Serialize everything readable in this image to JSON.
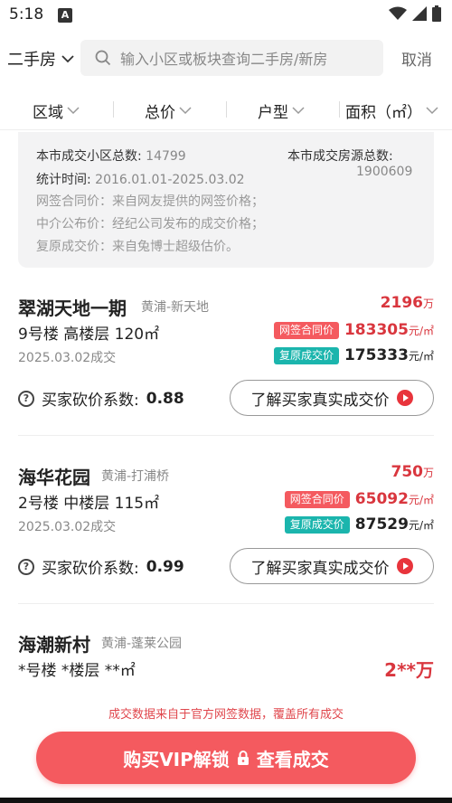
{
  "status": {
    "time": "5:18",
    "app_icon_letter": "A"
  },
  "search": {
    "city_label": "二手房",
    "placeholder": "输入小区或板块查询二手房/新房",
    "cancel_label": "取消"
  },
  "filters": [
    "区域",
    "总价",
    "户型",
    "面积（㎡）"
  ],
  "info": {
    "community_count_label": "本市成交小区总数:",
    "community_count_value": "14799",
    "listing_count_label": "本市成交房源总数:",
    "listing_count_value": "1900609",
    "period_label": "统计时间:",
    "period_value": "2016.01.01-2025.03.02",
    "note1": "网签合同价：来自网友提供的网签价格；",
    "note2": "中介公布价：经纪公司发布的成交价格；",
    "note3": "复原成交价：来自兔博士超级估价。"
  },
  "listings": [
    {
      "name": "翠湖天地一期",
      "district": "黄浦-新天地",
      "total": "2196",
      "total_unit": "万",
      "spec": "9号楼 高楼层 120㎡",
      "date": "2025.03.02成交",
      "tag1": "网签合同价",
      "price1": "183305",
      "tag2": "复原成交价",
      "price2": "175333",
      "price_unit": "元/㎡",
      "coef_label": "买家砍价系数:",
      "coef_value": "0.88",
      "cta": "了解买家真实成交价"
    },
    {
      "name": "海华花园",
      "district": "黄浦-打浦桥",
      "total": "750",
      "total_unit": "万",
      "spec": "2号楼 中楼层 115㎡",
      "date": "2025.03.02成交",
      "tag1": "网签合同价",
      "price1": "65092",
      "tag2": "复原成交价",
      "price2": "87529",
      "price_unit": "元/㎡",
      "coef_label": "买家砍价系数:",
      "coef_value": "0.99",
      "cta": "了解买家真实成交价"
    },
    {
      "name": "海潮新村",
      "district": "黄浦-蓬莱公园",
      "total_masked": "2**万",
      "spec": "*号楼 *楼层 **㎡"
    }
  ],
  "footnote": "成交数据来自于官方网签数据，覆盖所有成交",
  "vip_button": {
    "left": "购买VIP解锁",
    "right": "查看成交"
  },
  "colors": {
    "accent": "#f45a5f",
    "price_red": "#d9363e",
    "teal": "#1bb5ad"
  }
}
